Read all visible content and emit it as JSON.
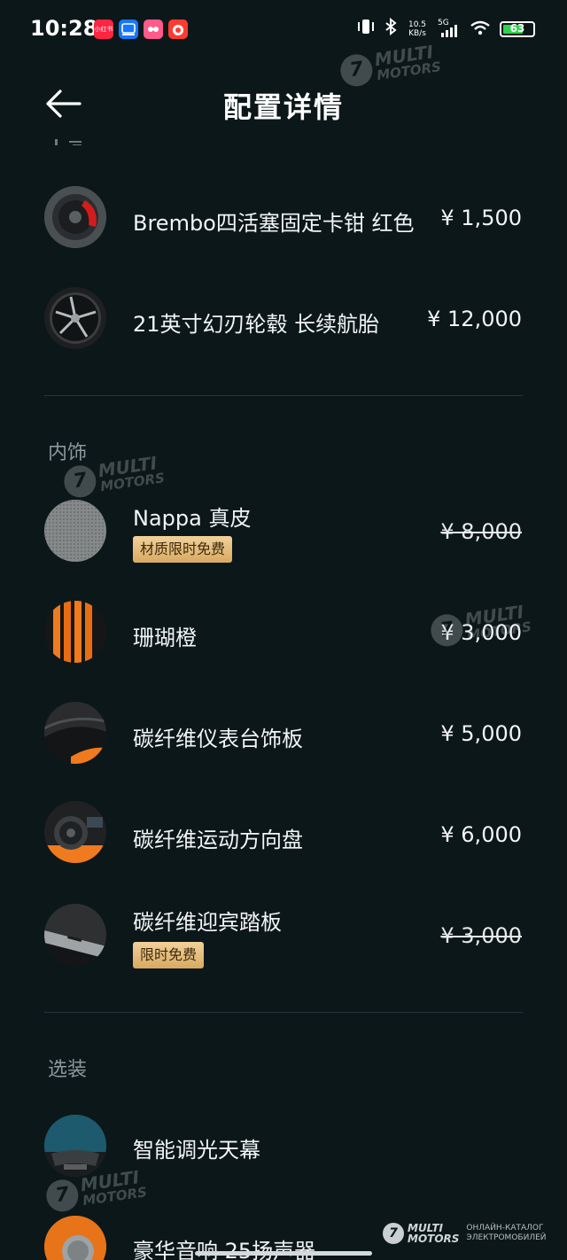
{
  "status_bar": {
    "time": "10:28",
    "app_icons": [
      {
        "name": "xiaohongshu-icon",
        "label": "小红书",
        "color": "#ff2442"
      },
      {
        "name": "alipay-icon",
        "label": "",
        "color": "#1677ff"
      },
      {
        "name": "app-pink-icon",
        "label": "",
        "color": "#ff5a8a"
      },
      {
        "name": "app-red-icon",
        "label": "",
        "color": "#ff3b30"
      }
    ],
    "net_speed_value": "10.5",
    "net_speed_unit": "KB/s",
    "signal_type": "5G",
    "battery_level": "63"
  },
  "header": {
    "title": "配置详情",
    "back_icon": "arrow-left-icon"
  },
  "sections": {
    "wheels": {
      "items": [
        {
          "name": "Brembo四活塞固定卡钳 红色",
          "price": "¥ 1,500",
          "icon": "brake-caliper-thumb"
        },
        {
          "name": "21英寸幻刃轮毂 长续航胎",
          "price": "¥ 12,000",
          "icon": "wheel-rim-thumb"
        }
      ]
    },
    "interior": {
      "title": "内饰",
      "items": [
        {
          "name": "Nappa 真皮",
          "price": "¥ 8,000",
          "badge": "材质限时免费",
          "struck": true,
          "icon": "leather-thumb"
        },
        {
          "name": "珊瑚橙",
          "price": "¥ 3,000",
          "struck": false,
          "icon": "coral-orange-thumb"
        },
        {
          "name": "碳纤维仪表台饰板",
          "price": "¥ 5,000",
          "struck": false,
          "icon": "carbon-dash-thumb"
        },
        {
          "name": "碳纤维运动方向盘",
          "price": "¥ 6,000",
          "struck": false,
          "icon": "steering-wheel-thumb"
        },
        {
          "name": "碳纤维迎宾踏板",
          "price": "¥ 3,000",
          "badge": "限时免费",
          "struck": true,
          "icon": "door-sill-thumb"
        }
      ]
    },
    "options": {
      "title": "选装",
      "items": [
        {
          "name": "智能调光天幕",
          "icon": "sky-roof-thumb"
        },
        {
          "name": "豪华音响 25扬声器",
          "icon": "speaker-thumb"
        }
      ]
    }
  },
  "watermark": {
    "brand_line1": "MULTI",
    "brand_line2": "MOTORS",
    "disc_glyph": "7",
    "footer_caption_line1": "ОНЛАЙН-КАТАЛОГ",
    "footer_caption_line2": "ЭЛЕКТРОМОБИЛЕЙ"
  },
  "colors": {
    "background": "#0c1719",
    "badge_gold": "#e4bb78",
    "accent_orange": "#f07a1e",
    "caliper_red": "#d41c1c"
  }
}
